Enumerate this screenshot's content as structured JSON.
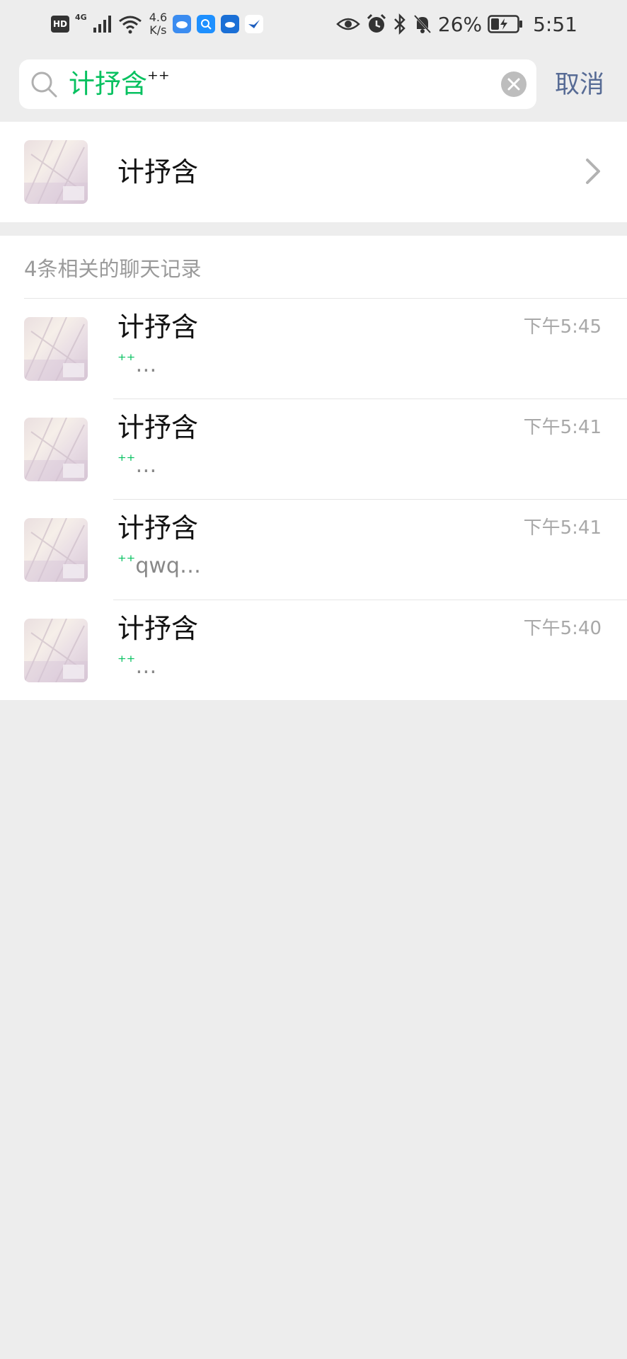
{
  "status_bar": {
    "hd": "HD",
    "network": "4G",
    "speed_value": "4.6",
    "speed_unit": "K/s",
    "battery": "26%",
    "time": "5:51"
  },
  "search": {
    "query": "计抒含",
    "query_suffix": "⁺⁺",
    "cancel_label": "取消"
  },
  "contact": {
    "name": "计抒含"
  },
  "records": {
    "header": "4条相关的聊天记录",
    "items": [
      {
        "name": "计抒含",
        "time": "下午5:45",
        "highlight": "⁺⁺",
        "snippet": "…"
      },
      {
        "name": "计抒含",
        "time": "下午5:41",
        "highlight": "⁺⁺",
        "snippet": "…"
      },
      {
        "name": "计抒含",
        "time": "下午5:41",
        "highlight": "⁺⁺",
        "snippet": "qwq…"
      },
      {
        "name": "计抒含",
        "time": "下午5:40",
        "highlight": "⁺⁺",
        "snippet": "…"
      }
    ]
  },
  "colors": {
    "accent_green": "#07c160",
    "link_blue": "#576b95",
    "background": "#ededed"
  },
  "icons": [
    "search-icon",
    "clear-icon",
    "chevron-right-icon",
    "eye-icon",
    "alarm-icon",
    "bluetooth-icon",
    "mute-icon",
    "battery-icon",
    "wifi-icon",
    "signal-icon"
  ]
}
